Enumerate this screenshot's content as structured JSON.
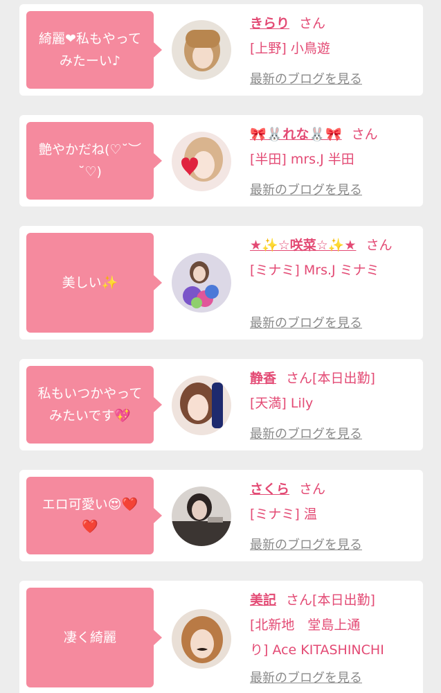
{
  "colors": {
    "page_bg": "#ededed",
    "card_bg": "#ffffff",
    "bubble_bg": "#f58a9e",
    "accent_text": "#e34a74",
    "link_gray": "#8a8a8a"
  },
  "blog_link_label": "最新のブログを見る",
  "san_label": "さん",
  "entries": [
    {
      "comment": "綺麗❤私もやって\nみたーい♪",
      "girl_name": "きらり",
      "tag": "",
      "shop": "[上野] 小鳥遊",
      "avatar_icon": "avatar-photo"
    },
    {
      "comment": "艶やかだね(♡˘︶\n˘♡)",
      "girl_name": "🎀🐰れな🐰🎀",
      "tag": "",
      "shop": "[半田] mrs.J 半田",
      "avatar_icon": "avatar-photo"
    },
    {
      "comment": "美しい✨",
      "girl_name": "★✨☆咲菜☆✨★",
      "tag": "",
      "shop": "[ミナミ] Mrs.J ミナミ",
      "avatar_icon": "avatar-photo"
    },
    {
      "comment": "私もいつかやって\nみたいです💖",
      "girl_name": "静香",
      "tag": "[本日出勤]",
      "shop": "[天満] Lily",
      "avatar_icon": "avatar-photo"
    },
    {
      "comment": "エロ可愛い😍❤️\n❤️",
      "girl_name": "さくら",
      "tag": "",
      "shop": "[ミナミ] 温",
      "avatar_icon": "avatar-photo"
    },
    {
      "comment": "凄く綺麗",
      "girl_name": "美記",
      "tag": "[本日出勤]",
      "shop": "[北新地　堂島上通\nり] Ace KITASHINCHI",
      "avatar_icon": "avatar-photo"
    }
  ]
}
